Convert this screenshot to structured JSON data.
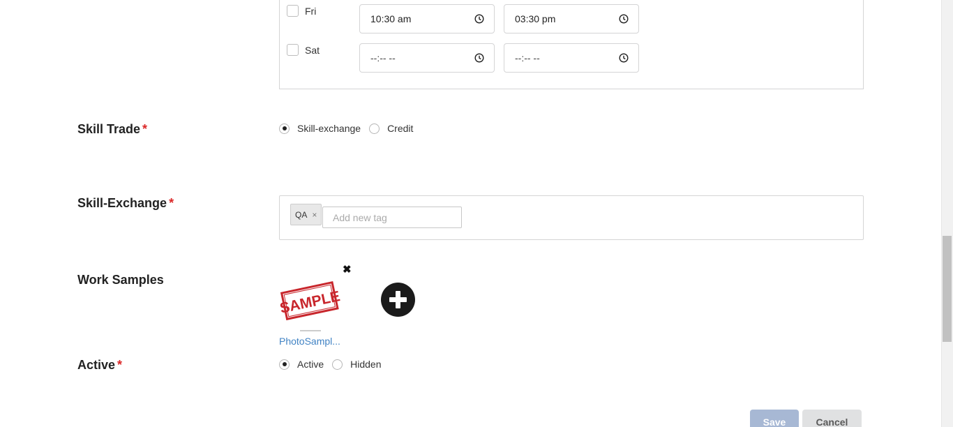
{
  "availability": {
    "rows": [
      {
        "day": "Fri",
        "checked": false,
        "start": "10:30 am",
        "end": "03:30 pm"
      },
      {
        "day": "Sat",
        "checked": false,
        "start": "--:-- --",
        "end": "--:-- --"
      }
    ]
  },
  "skill_trade": {
    "label": "Skill Trade",
    "required_mark": "*",
    "options": [
      {
        "label": "Skill-exchange",
        "checked": true
      },
      {
        "label": "Credit",
        "checked": false
      }
    ]
  },
  "skill_exchange": {
    "label": "Skill-Exchange",
    "required_mark": "*",
    "tags": [
      {
        "label": "QA",
        "remove": "×"
      }
    ],
    "input_placeholder": "Add new tag"
  },
  "work_samples": {
    "label": "Work Samples",
    "remove_icon": "✖",
    "files": [
      {
        "name": "PhotoSampl...",
        "thumbnail_text": "SAMPLE"
      }
    ],
    "add_icon": "plus-circle-icon"
  },
  "active": {
    "label": "Active",
    "required_mark": "*",
    "options": [
      {
        "label": "Active",
        "checked": true
      },
      {
        "label": "Hidden",
        "checked": false
      }
    ]
  },
  "actions": {
    "save_label": "Save",
    "cancel_label": "Cancel"
  },
  "colors": {
    "required": "#db2828",
    "link": "#4183c4",
    "save_bg": "#a7b8d4",
    "cancel_bg": "#e0e1e2",
    "stamp_red": "#c8262c"
  }
}
